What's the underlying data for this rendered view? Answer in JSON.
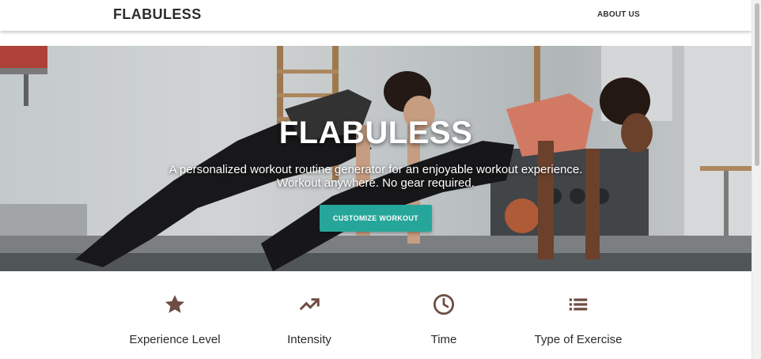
{
  "navbar": {
    "brand": "FLABULESS",
    "links": [
      {
        "label": "ABOUT US"
      }
    ]
  },
  "hero": {
    "title": "FLABULESS",
    "subtitle_line1": "A personalized workout routine generator for an enjoyable workout experience.",
    "subtitle_line2": "Workout anywhere. No gear required.",
    "cta_label": "CUSTOMIZE WORKOUT"
  },
  "features": [
    {
      "title": "Experience Level",
      "icon": "star-icon"
    },
    {
      "title": "Intensity",
      "icon": "trending-up-icon"
    },
    {
      "title": "Time",
      "icon": "clock-icon"
    },
    {
      "title": "Type of Exercise",
      "icon": "list-icon"
    }
  ],
  "colors": {
    "accent": "#26a69a",
    "feature_icon": "#6d4c41"
  }
}
